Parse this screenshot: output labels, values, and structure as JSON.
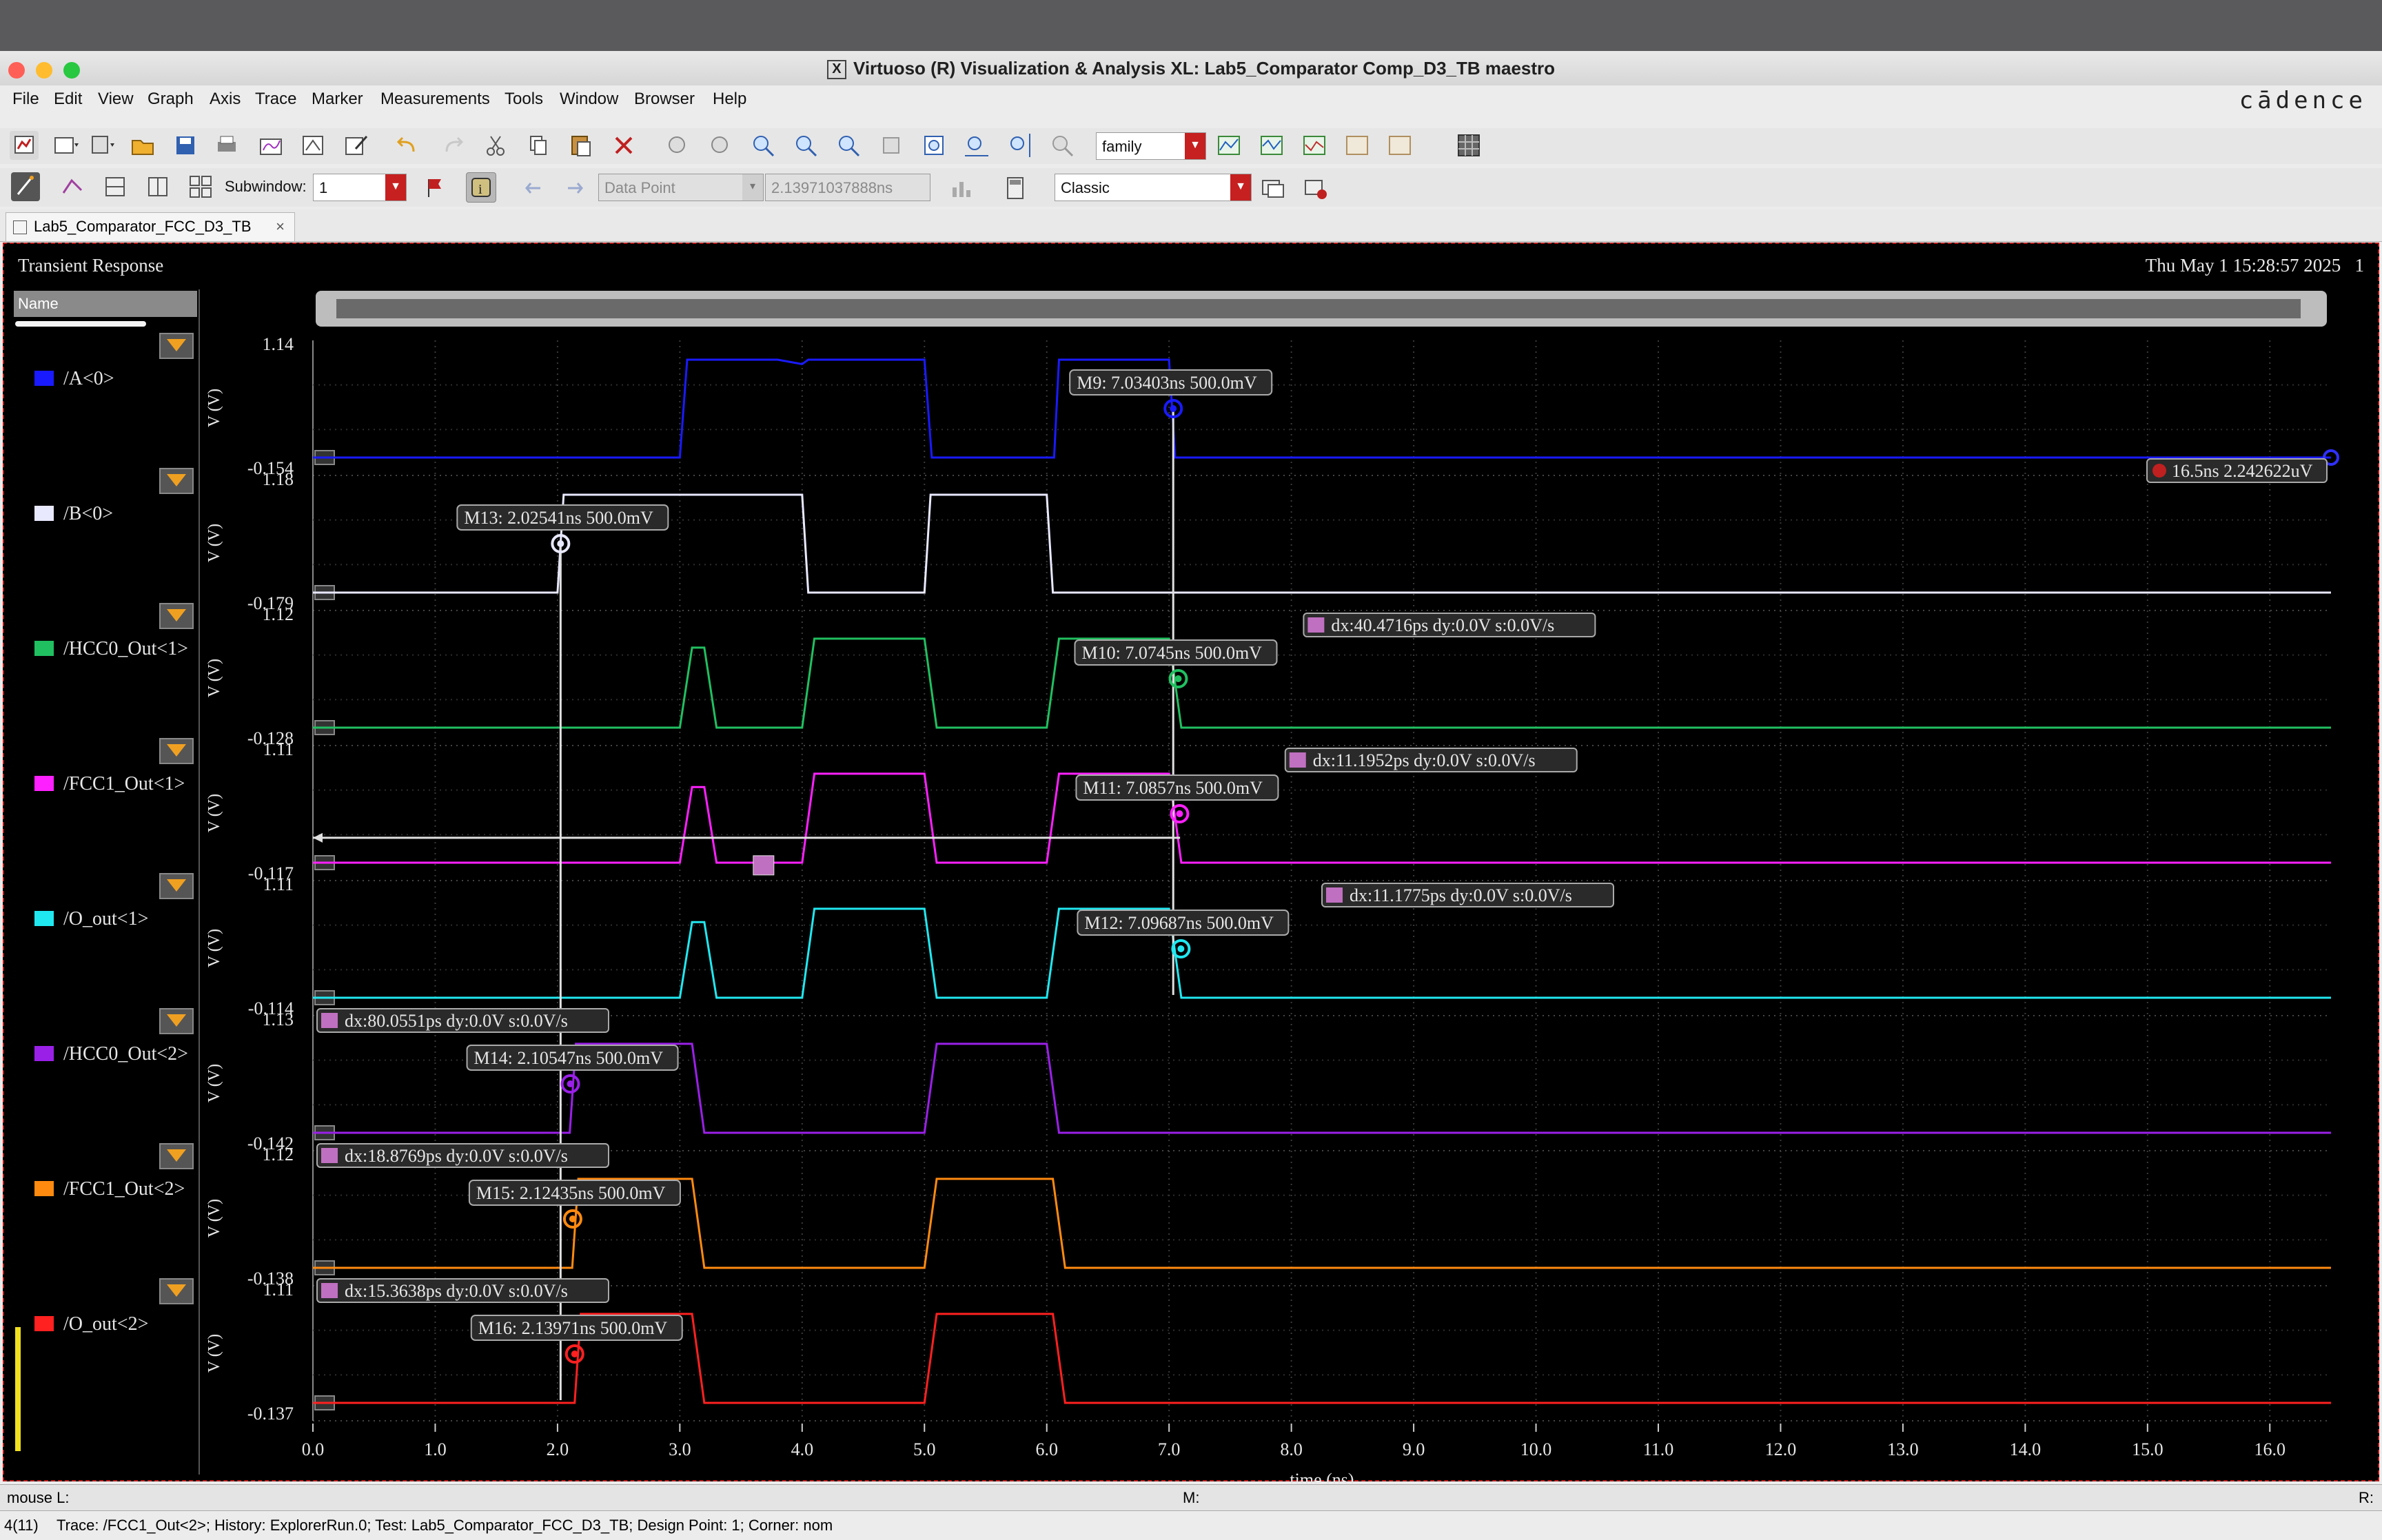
{
  "window": {
    "title": "Virtuoso (R) Visualization & Analysis XL: Lab5_Comparator Comp_D3_TB maestro"
  },
  "menubar": {
    "items": [
      "File",
      "Edit",
      "View",
      "Graph",
      "Axis",
      "Trace",
      "Marker",
      "Measurements",
      "Tools",
      "Window",
      "Browser",
      "Help"
    ],
    "brand": "cādence"
  },
  "toolbar1": {
    "family_value": "family"
  },
  "toolbar2": {
    "subwindow_label": "Subwindow:",
    "subwindow_value": "1",
    "datapoint_value": "Data Point",
    "time_value": "2.13971037888ns",
    "style_value": "Classic"
  },
  "tab": {
    "label": "Lab5_Comparator_FCC_D3_TB"
  },
  "plot": {
    "title": "Transient Response",
    "datetime": "Thu May 1 15:28:57 2025",
    "corner_num": "1",
    "legend_header": "Name",
    "xlabel": "time (ns)",
    "ylabel": "V (V)"
  },
  "chart_data": {
    "type": "line",
    "xlabel": "time (ns)",
    "ylabel": "V (V)",
    "xlim": [
      0.0,
      16.5
    ],
    "xticks": [
      "0.0",
      "1.0",
      "2.0",
      "3.0",
      "4.0",
      "5.0",
      "6.0",
      "7.0",
      "8.0",
      "9.0",
      "10.0",
      "11.0",
      "12.0",
      "13.0",
      "14.0",
      "15.0",
      "16.0"
    ],
    "series": [
      {
        "name": "/A<0>",
        "color": "#1a1aff",
        "ymax_label": "1.14",
        "ymin_label": "-0.154",
        "x": [
          0,
          3.0,
          3.06,
          3.8,
          4.0,
          4.05,
          5.0,
          5.06,
          6.0,
          6.06,
          6.1,
          7.0,
          7.05,
          16.5
        ],
        "y": [
          0,
          0,
          1.1,
          1.1,
          1.05,
          1.1,
          1.1,
          0,
          0,
          0,
          1.1,
          1.1,
          0,
          0
        ]
      },
      {
        "name": "/B<0>",
        "color": "#e8e8ff",
        "ymax_label": "1.18",
        "ymin_label": "-0.179",
        "x": [
          0,
          2.0,
          2.05,
          4.0,
          4.05,
          5.0,
          5.05,
          6.0,
          6.05,
          16.5
        ],
        "y": [
          0,
          0,
          1.1,
          1.1,
          0,
          0,
          1.1,
          1.1,
          0,
          0
        ]
      },
      {
        "name": "/HCC0_Out<1>",
        "color": "#20c060",
        "ymax_label": "1.12",
        "ymin_label": "-0.128",
        "x": [
          0,
          3.0,
          3.1,
          3.2,
          3.3,
          4.0,
          4.1,
          5.0,
          5.1,
          6.0,
          6.1,
          7.0,
          7.1,
          16.5
        ],
        "y": [
          0,
          0,
          0.9,
          0.9,
          0,
          0,
          1.0,
          1.0,
          0,
          0,
          1.0,
          1.0,
          0,
          0
        ]
      },
      {
        "name": "/FCC1_Out<1>",
        "color": "#ff20ff",
        "ymax_label": "1.11",
        "ymin_label": "-0.117",
        "x": [
          0,
          3.0,
          3.1,
          3.2,
          3.3,
          4.0,
          4.1,
          5.0,
          5.1,
          6.0,
          6.1,
          7.0,
          7.1,
          16.5
        ],
        "y": [
          0,
          0,
          0.85,
          0.85,
          0,
          0,
          1.0,
          1.0,
          0,
          0,
          1.0,
          1.0,
          0,
          0
        ]
      },
      {
        "name": "/O_out<1>",
        "color": "#20e8f0",
        "ymax_label": "1.11",
        "ymin_label": "-0.114",
        "x": [
          0,
          3.0,
          3.1,
          3.2,
          3.3,
          4.0,
          4.1,
          5.0,
          5.1,
          6.0,
          6.1,
          7.0,
          7.1,
          16.5
        ],
        "y": [
          0,
          0,
          0.85,
          0.85,
          0,
          0,
          1.0,
          1.0,
          0,
          0,
          1.0,
          1.0,
          0,
          0
        ]
      },
      {
        "name": "/HCC0_Out<2>",
        "color": "#9a20e8",
        "ymax_label": "1.13",
        "ymin_label": "-0.142",
        "x": [
          0,
          2.1,
          2.15,
          3.1,
          3.2,
          5.0,
          5.1,
          6.0,
          6.1,
          16.5
        ],
        "y": [
          0,
          0,
          1.0,
          1.0,
          0,
          0,
          1.0,
          1.0,
          0,
          0
        ]
      },
      {
        "name": "/FCC1_Out<2>",
        "color": "#ff8a10",
        "ymax_label": "1.12",
        "ymin_label": "-0.138",
        "x": [
          0,
          2.12,
          2.17,
          3.1,
          3.2,
          5.0,
          5.1,
          6.05,
          6.15,
          16.5
        ],
        "y": [
          0,
          0,
          1.0,
          1.0,
          0,
          0,
          1.0,
          1.0,
          0,
          0
        ]
      },
      {
        "name": "/O_out<2>",
        "color": "#ff2020",
        "ymax_label": "1.11",
        "ymin_label": "-0.137",
        "x": [
          0,
          2.14,
          2.19,
          3.1,
          3.2,
          5.0,
          5.1,
          6.05,
          6.15,
          16.5
        ],
        "y": [
          0,
          0,
          1.0,
          1.0,
          0,
          0,
          1.0,
          1.0,
          0,
          0
        ]
      }
    ],
    "markers": [
      {
        "label": "M9: 7.03403ns 500.0mV",
        "series": 0,
        "x": 7.034
      },
      {
        "label": "M13: 2.02541ns 500.0mV",
        "series": 1,
        "x": 2.025
      },
      {
        "label": "M10: 7.0745ns 500.0mV",
        "series": 2,
        "x": 7.075
      },
      {
        "label": "M11: 7.0857ns 500.0mV",
        "series": 3,
        "x": 7.086
      },
      {
        "label": "M12: 7.09687ns 500.0mV",
        "series": 4,
        "x": 7.097
      },
      {
        "label": "M14: 2.10547ns 500.0mV",
        "series": 5,
        "x": 2.105
      },
      {
        "label": "M15: 2.12435ns 500.0mV",
        "series": 6,
        "x": 2.124
      },
      {
        "label": "M16: 2.13971ns 500.0mV",
        "series": 7,
        "x": 2.14
      }
    ],
    "delta_labels": [
      {
        "label": "dx:40.4716ps dy:0.0V s:0.0V/s",
        "series": 2
      },
      {
        "label": "dx:11.1952ps dy:0.0V s:0.0V/s",
        "series": 3
      },
      {
        "label": "dx:11.1775ps dy:0.0V s:0.0V/s",
        "series": 4
      },
      {
        "label": "dx:80.0551ps dy:0.0V s:0.0V/s",
        "series": 5
      },
      {
        "label": "dx:18.8769ps dy:0.0V s:0.0V/s",
        "series": 6
      },
      {
        "label": "dx:15.3638ps dy:0.0V s:0.0V/s",
        "series": 7
      }
    ],
    "a_marker": {
      "label": "16.5ns 2.242622uV",
      "series": 0,
      "x": 16.5
    }
  },
  "mousebar": {
    "left": "mouse L:",
    "mid": "M:",
    "right": "R:"
  },
  "statusbar": {
    "count": "4(11)",
    "text": "Trace: /FCC1_Out<2>; History: ExplorerRun.0; Test: Lab5_Comparator_FCC_D3_TB; Design Point: 1; Corner: nom"
  }
}
